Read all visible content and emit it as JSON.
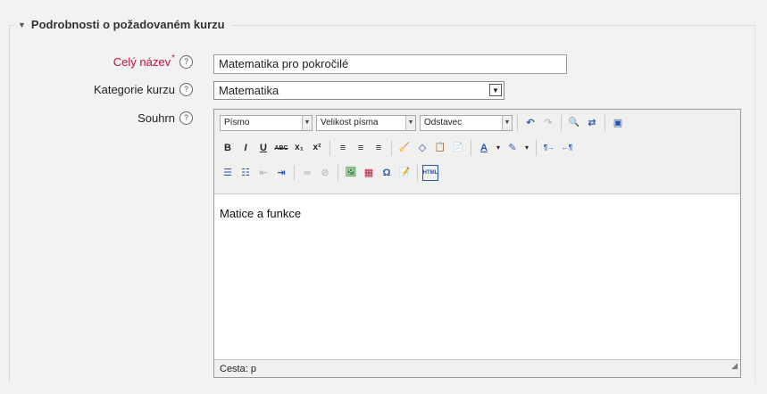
{
  "section": {
    "title": "Podrobnosti o požadovaném kurzu"
  },
  "fields": {
    "fullname": {
      "label": "Celý název",
      "value": "Matematika pro pokročilé"
    },
    "category": {
      "label": "Kategorie kurzu",
      "value": "Matematika"
    },
    "summary": {
      "label": "Souhrn"
    }
  },
  "editor": {
    "font_select": "Písmo",
    "size_select": "Velikost písma",
    "format_select": "Odstavec",
    "content": "Matice a funkce",
    "status": "Cesta: p",
    "glyphs": {
      "undo": "↶",
      "redo": "↷",
      "find": "🔍",
      "replace": "⇄",
      "fullscreen": "▣",
      "bold": "B",
      "italic": "I",
      "underline": "U",
      "strike": "ABC",
      "subscript": "x₁",
      "superscript": "x²",
      "align_left": "≡",
      "align_center": "≡",
      "align_right": "≡",
      "cleanup": "🧹",
      "eraser": "◇",
      "paste_text": "📋",
      "paste_word": "📄",
      "forecolor": "A",
      "backcolor": "✎",
      "ltr": "¶→",
      "rtl": "←¶",
      "bullist": "☰",
      "numlist": "☷",
      "outdent": "⇤",
      "indent": "⇥",
      "link": "∞",
      "unlink": "⊘",
      "image": "🖼",
      "media": "▦",
      "charmap": "Ω",
      "edit": "📝",
      "html": "HTML"
    }
  },
  "colors": {
    "required": "#c0103a",
    "accent_blue": "#2a55b0"
  }
}
